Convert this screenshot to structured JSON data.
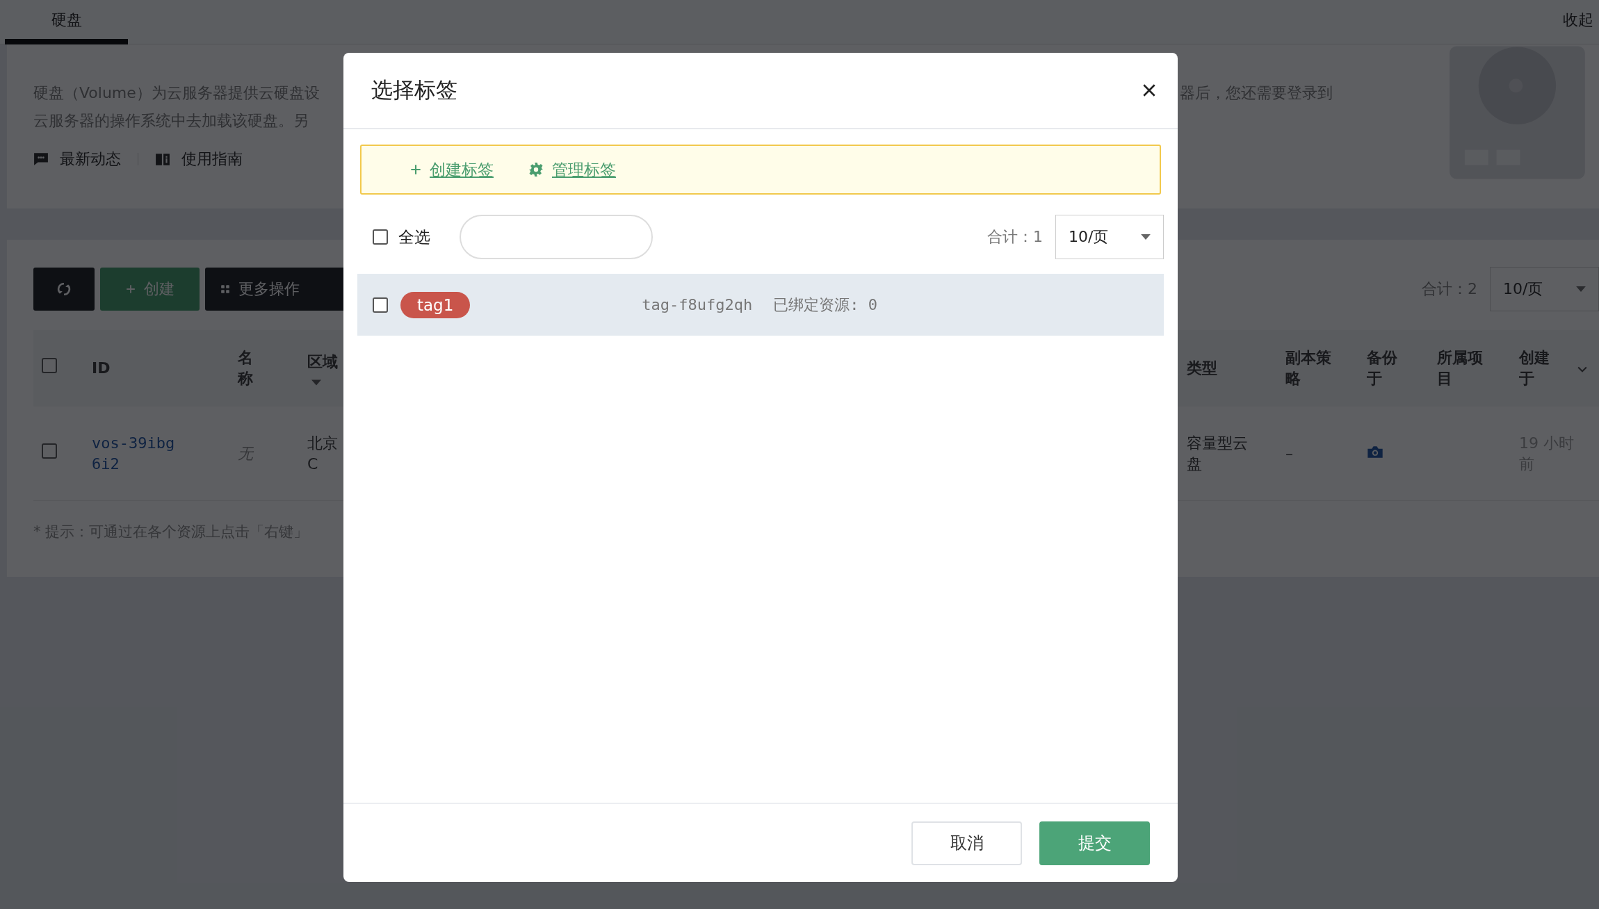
{
  "page": {
    "tabs": [
      {
        "label": "硬盘",
        "selected": true
      }
    ],
    "collapse": "收起",
    "intro": {
      "left_lines": [
        "硬盘（Volume）为云服务器提供云硬盘设",
        "云服务器的操作系统中去加载该硬盘。另"
      ],
      "right_line": "器后，您还需要登录到",
      "links": [
        {
          "kind": "news",
          "label": "最新动态"
        },
        {
          "kind": "guide",
          "label": "使用指南"
        }
      ]
    },
    "toolbar": {
      "buttons": [
        {
          "kind": "refresh"
        },
        {
          "kind": "create",
          "label": "创建"
        },
        {
          "kind": "more",
          "label": "更多操作"
        }
      ],
      "total": "合计：2",
      "page_size": "10/页"
    },
    "table": {
      "header_checked": false,
      "columns_left": [
        {
          "label": "ID"
        },
        {
          "label": "名称"
        },
        {
          "label": "区域",
          "filter": true
        }
      ],
      "columns_right": [
        {
          "label": "类型"
        },
        {
          "label": "副本策略"
        },
        {
          "label": "备份于"
        },
        {
          "label": "所属项目"
        },
        {
          "label": "创建于"
        }
      ],
      "rows": [
        {
          "checked": false,
          "id": "vos-39ibg6i2",
          "name": "无",
          "region": "北京 C",
          "type": "容量型云盘",
          "replica": "–",
          "created": "19 小时前"
        }
      ]
    },
    "hint": "* 提示：可通过在各个资源上点击「右键」"
  },
  "dialog": {
    "title": "选择标签",
    "actions": [
      {
        "kind": "create",
        "label": "创建标签"
      },
      {
        "kind": "manage",
        "label": "管理标签"
      }
    ],
    "select_all": {
      "label": "全选",
      "checked": false
    },
    "total": "合计：1",
    "page_size": "10/页",
    "tags": [
      {
        "name": "tag1",
        "color": "#c9554b",
        "id": "tag-f8ufg2qh",
        "bound": "已绑定资源: 0",
        "checked": false
      }
    ],
    "buttons": [
      {
        "kind": "cancel",
        "label": "取消"
      },
      {
        "kind": "submit",
        "label": "提交"
      }
    ]
  }
}
